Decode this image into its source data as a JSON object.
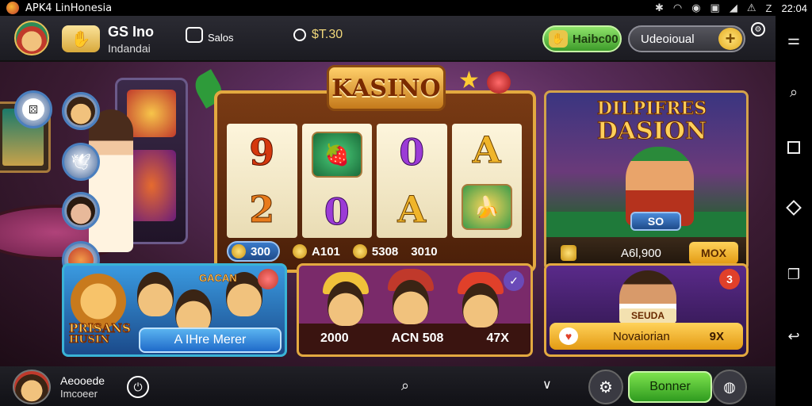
{
  "status_bar": {
    "title": "APK4 LinHonesia",
    "time": "22:04",
    "icons": [
      "bluetooth-icon",
      "wifi-icon",
      "rec-icon",
      "sim-icon",
      "signal-icon",
      "no-sim-icon",
      "z-icon"
    ]
  },
  "header": {
    "brand_name": "GS Ino",
    "brand_sub": "Indandai",
    "sales_label": "Salos",
    "balance": "$T.30",
    "green_button": "Haibc00",
    "dark_button": "Udeoioual",
    "plus": "+"
  },
  "slot": {
    "title": "KASINO",
    "reels": [
      [
        "9",
        "2"
      ],
      [
        "fruit",
        "0"
      ],
      [
        "0",
        "A"
      ],
      [
        "A",
        "banana"
      ]
    ],
    "stats": [
      {
        "value": "300",
        "style": "pill"
      },
      {
        "value": "A101",
        "style": "plain"
      },
      {
        "value": "5308",
        "style": "plain"
      },
      {
        "value": "3010",
        "style": "plain"
      }
    ]
  },
  "promo": {
    "title_line1": "DILPIFRES",
    "title_line2": "DASION",
    "badge": "SO",
    "amount": "A6l,900",
    "button": "MOX"
  },
  "cards": {
    "card1": {
      "brand1": "PRISANS",
      "brand2": "HUSIN",
      "tag": "GACAN",
      "button": "A IHre Merer"
    },
    "card2": {
      "stats": [
        "2000",
        "ACN 508",
        "47X"
      ],
      "check": "✓"
    },
    "card3": {
      "badge": "3",
      "sign": "SEUDA",
      "label": "Novaiorian",
      "mult": "9X"
    }
  },
  "bottom_bar": {
    "name1": "Aeooede",
    "name2": "Imcoeer",
    "button": "Bonner"
  },
  "nav_rail": [
    "menu-icon",
    "search-icon",
    "square-icon",
    "diamond-icon",
    "copy-icon",
    "back-icon"
  ]
}
